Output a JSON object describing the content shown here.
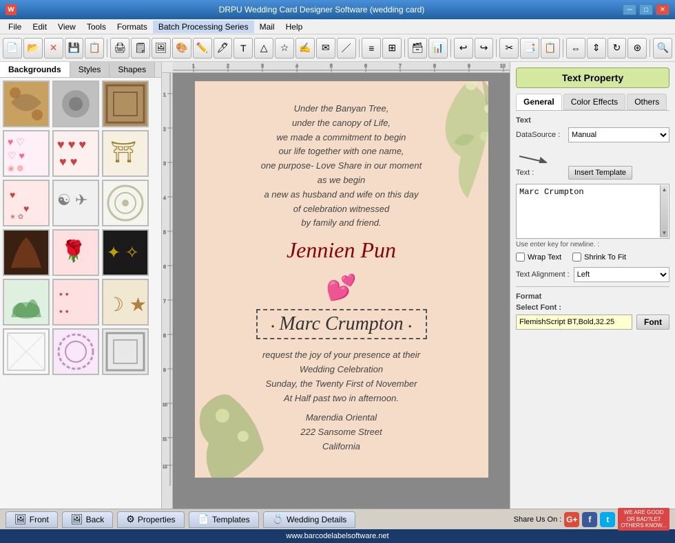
{
  "title": "DRPU Wedding Card Designer Software (wedding card)",
  "menu": {
    "items": [
      "File",
      "Edit",
      "View",
      "Tools",
      "Formats",
      "Batch Processing Series",
      "Mail",
      "Help"
    ]
  },
  "tabs": {
    "backgrounds": "Backgrounds",
    "styles": "Styles",
    "shapes": "Shapes"
  },
  "card": {
    "text_top": "Under the Banyan Tree,\nunder the canopy of Life,\nwe made a commitment to begin\nour life together with one name,\none purpose- Love Share in our moment\nas we begin\na new as husband and wife on this day\nof celebration witnessed\nby family and friend.",
    "name1": "Jennien Pun",
    "hearts": "💕",
    "name2": "Marc Crumpton",
    "text_bottom": "request the joy of your presence at their\nWedding Celebration\nSunday, the Twenty First of November\nAt Half past two in afternoon.",
    "address": "Marendia Oriental\n222 Sansome Street\nCalifornia"
  },
  "right_panel": {
    "header": "Text Property",
    "tabs": [
      "General",
      "Color Effects",
      "Others"
    ],
    "active_tab": "General",
    "datasource_label": "DataSource :",
    "datasource_value": "Manual",
    "text_label": "Text :",
    "insert_template_label": "Insert Template",
    "text_content": "Marc Crumpton",
    "hint": "Use enter key for newline. :",
    "wrap_text": "Wrap Text",
    "shrink_to_fit": "Shrink To Fit",
    "text_alignment_label": "Text Alignment :",
    "alignment_value": "Left",
    "format_label": "Format",
    "select_font_label": "Select Font :",
    "font_value": "FlemishScript BT,Bold,32.25",
    "font_button": "Font"
  },
  "bottom_bar": {
    "front": "Front",
    "back": "Back",
    "properties": "Properties",
    "templates": "Templates",
    "wedding_details": "Wedding Details",
    "share_label": "Share Us On :"
  },
  "footer": {
    "url": "www.barcodelabelsoftware.net"
  }
}
